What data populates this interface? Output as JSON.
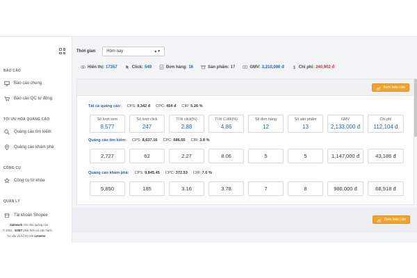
{
  "sidebar": {
    "sections": [
      {
        "title": "BÁO CÁO",
        "items": [
          {
            "label": "Báo cáo chung",
            "icon": "monitor-icon"
          },
          {
            "label": "Báo cáo QC tự động",
            "icon": "cart-icon"
          }
        ]
      },
      {
        "title": "TỐI ƯU HÓA QUẢNG CÁO",
        "items": [
          {
            "label": "Quảng cáo tìm kiếm",
            "icon": "search-icon"
          },
          {
            "label": "Quảng cáo khám phá",
            "icon": "location-pin-icon"
          }
        ]
      },
      {
        "title": "CÔNG CỤ",
        "items": [
          {
            "label": "Công cụ từ khóa",
            "icon": "star-icon"
          }
        ]
      },
      {
        "title": "QUẢN LÝ",
        "items": [
          {
            "label": "Tài khoản Shopee",
            "icon": "shop-icon"
          }
        ]
      }
    ],
    "footer": {
      "line1_brand": "Salework",
      "line1_rest": " cho nhà quảng cáo",
      "line2": "© 2021 - ",
      "line2_brand": "ESET",
      "line2_rest": " phát triển và vận hành",
      "line3": "Tư vấn và hỗ trợ bởi ",
      "line3_brand": "Lemeno"
    }
  },
  "filter": {
    "label": "Thời gian",
    "value": "Hôm nay",
    "caret": "▲▼"
  },
  "summary": [
    {
      "key": "Hiển thị:",
      "value": "17357",
      "icon": "eye-icon",
      "color": "#1f5fb8"
    },
    {
      "key": "Click:",
      "value": "549",
      "icon": "cursor-icon",
      "color": "#1f5fb8"
    },
    {
      "key": "Đơn hàng:",
      "value": "16",
      "icon": "order-icon",
      "color": "#1f5fb8"
    },
    {
      "key": "Sản phẩm:",
      "value": "17",
      "icon": "box-icon",
      "color": "#1f5fb8"
    },
    {
      "key": "GMV:",
      "value": "3,210,000 đ",
      "icon": "gmv-icon",
      "color": "#1f5fb8"
    },
    {
      "key": "Chi phí:",
      "value": "240,902 đ",
      "icon": "dollar-icon",
      "color": "#d12b2b"
    }
  ],
  "report_button": "Xem báo cáo",
  "all_ads": {
    "title": "Tất cả quảng cáo:",
    "cps_label": "CPS:",
    "cps": "9,342 đ",
    "cpc_label": "CPC:",
    "cpc": "454 đ",
    "cir_label": "CIR:",
    "cir": "5.26 %",
    "cards": [
      {
        "key": "Số lượt xem",
        "value": "8,577"
      },
      {
        "key": "Số lượt click",
        "value": "247"
      },
      {
        "key": "Tỉ lệ click(%)",
        "value": "2.88"
      },
      {
        "key": "Tỉ lệ C.đổi(%)",
        "value": "4.86"
      },
      {
        "key": "Số đơn hàng",
        "value": "12"
      },
      {
        "key": "Số sản phẩm",
        "value": "13"
      },
      {
        "key": "GMV",
        "value": "2,133,000 đ"
      },
      {
        "key": "Chi phí",
        "value": "112,104 đ"
      }
    ]
  },
  "search_ads": {
    "title": "Quảng cáo tìm kiếm:",
    "cps_label": "CPS:",
    "cps": "8,637.16",
    "cpc_label": "CPC:",
    "cpc": "686.55",
    "cir_label": "CIR:",
    "cir": "3.8 %",
    "values": [
      "2,727",
      "62",
      "2.27",
      "8.06",
      "5",
      "5",
      "1,147,000 đ",
      "43,186 đ"
    ]
  },
  "discovery_ads": {
    "title": "Quảng cáo khám phá:",
    "cps_label": "CPS:",
    "cps": "9,845.45",
    "cpc_label": "CPC:",
    "cpc": "372.53",
    "cir_label": "CIR:",
    "cir": "7.0 %",
    "values": [
      "5,850",
      "185",
      "3.16",
      "3.78",
      "7",
      "8",
      "986,000 đ",
      "68,918 đ"
    ]
  }
}
